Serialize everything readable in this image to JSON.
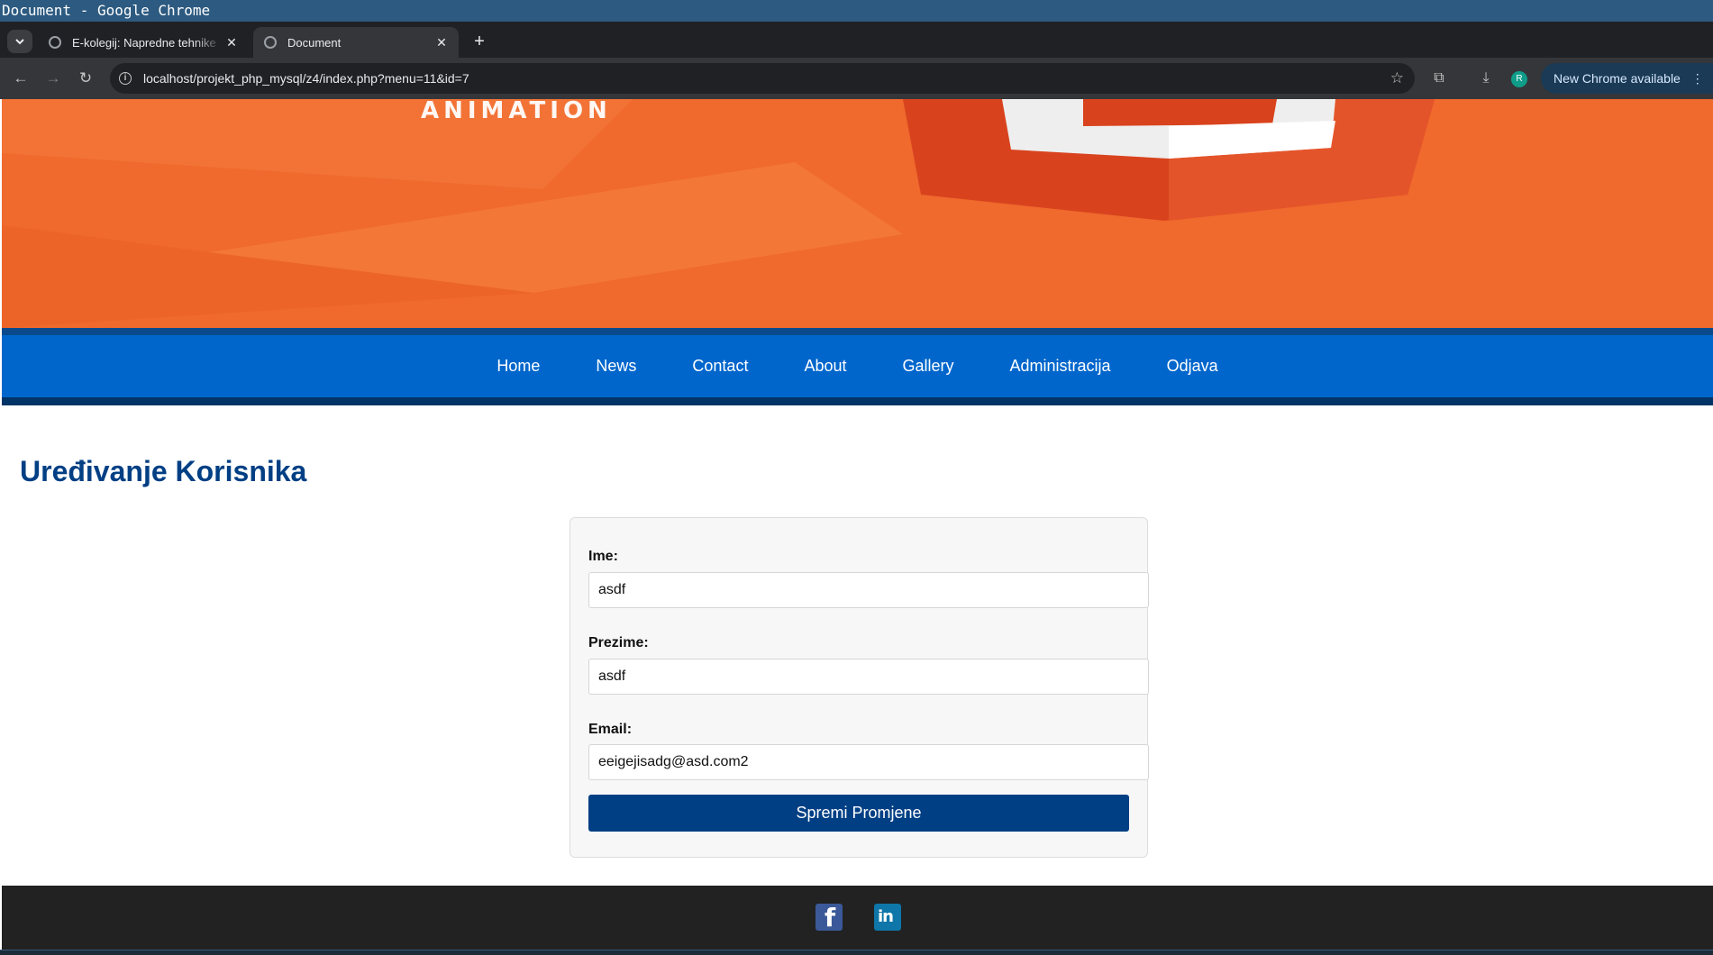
{
  "window": {
    "title": "Document - Google Chrome"
  },
  "tabs": [
    {
      "label": "E-kolegij: Napredne tehnike",
      "active": false
    },
    {
      "label": "Document",
      "active": true
    }
  ],
  "toolbar": {
    "url": "localhost/projekt_php_mysql/z4/index.php?menu=11&id=7",
    "profile_initial": "R",
    "update_label": "New Chrome available"
  },
  "banner": {
    "text": "ANIMATION"
  },
  "nav": {
    "items": [
      {
        "label": "Home"
      },
      {
        "label": "News"
      },
      {
        "label": "Contact"
      },
      {
        "label": "About"
      },
      {
        "label": "Gallery"
      },
      {
        "label": "Administracija"
      },
      {
        "label": "Odjava"
      }
    ]
  },
  "page": {
    "heading": "Uređivanje Korisnika"
  },
  "form": {
    "ime_label": "Ime:",
    "ime_value": "asdf",
    "prezime_label": "Prezime:",
    "prezime_value": "asdf",
    "email_label": "Email:",
    "email_value": "eeigejisadg@asd.com2",
    "submit_label": "Spremi Promjene"
  },
  "colors": {
    "brand_blue": "#0066cc",
    "heading_blue": "#003f84",
    "banner_orange": "#f0692d"
  },
  "icons": [
    "facebook-icon",
    "linkedin-icon"
  ]
}
